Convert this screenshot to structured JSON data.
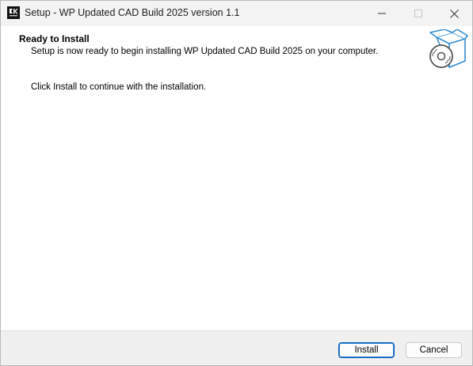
{
  "window": {
    "title": "Setup - WP Updated CAD Build 2025 version 1.1",
    "controls": {
      "minimize_icon": "minimize-icon",
      "maximize_icon": "maximize-icon",
      "close_icon": "close-icon"
    }
  },
  "header": {
    "title": "Ready to Install",
    "subtitle": "Setup is now ready to begin installing WP Updated CAD Build 2025 on your computer.",
    "graphic_icon": "box-disc-icon"
  },
  "main": {
    "instruction": "Click Install to continue with the installation."
  },
  "footer": {
    "install_label": "Install",
    "cancel_label": "Cancel"
  },
  "colors": {
    "titlebar_bg": "#f3f3f3",
    "footer_bg": "#f0f0f0",
    "accent_border": "#005fb8",
    "graphic_blue": "#2f8ed6"
  }
}
